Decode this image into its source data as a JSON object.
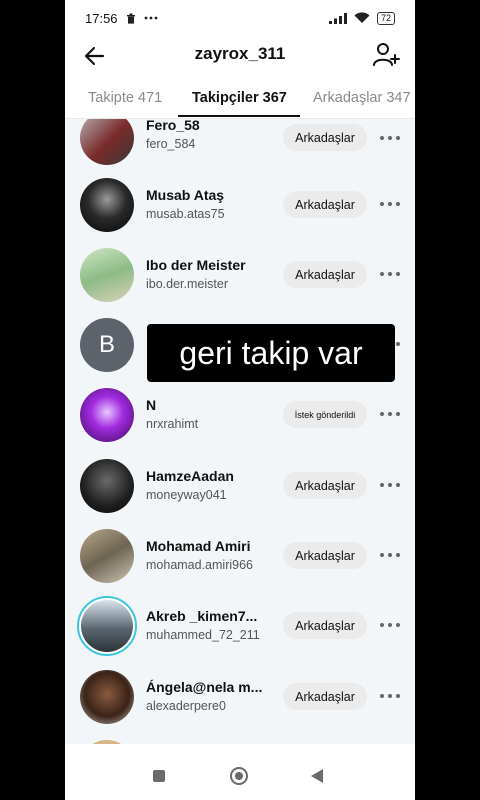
{
  "status": {
    "time": "17:56",
    "left_icons": [
      "trash-icon",
      "more-dots-icon"
    ],
    "battery": "72"
  },
  "header": {
    "title": "zayrox_311"
  },
  "tabs": [
    {
      "label": "Takipte 471"
    },
    {
      "label": "Takipçiler 367"
    },
    {
      "label": "Arkadaşlar 347"
    }
  ],
  "overlay_text": "geri takip var",
  "followers": [
    {
      "name": "Fero_58",
      "handle": "fero_584",
      "button": "Arkadaşlar"
    },
    {
      "name": "Musab Ataş",
      "handle": "musab.atas75",
      "button": "Arkadaşlar"
    },
    {
      "name": "Ibo der Meister",
      "handle": "ibo.der.meister",
      "button": "Arkadaşlar"
    },
    {
      "name": "",
      "handle": "",
      "button": "",
      "initial": "B"
    },
    {
      "name": "N",
      "handle": "nrxrahimt",
      "button": "İstek gönderildi"
    },
    {
      "name": "HamzeAadan",
      "handle": "moneyway041",
      "button": "Arkadaşlar"
    },
    {
      "name": "Mohamad  Amiri",
      "handle": "mohamad.amiri966",
      "button": "Arkadaşlar"
    },
    {
      "name": "Akreb _kimen7...",
      "handle": "muhammed_72_211",
      "button": "Arkadaşlar"
    },
    {
      "name": "Ángela@nela m...",
      "handle": "alexaderpere0",
      "button": "Arkadaşlar"
    }
  ],
  "colors": {
    "story_ring": "#3ec6e0",
    "list_bg": "#f2f6f8",
    "button_bg": "#ebebeb"
  }
}
